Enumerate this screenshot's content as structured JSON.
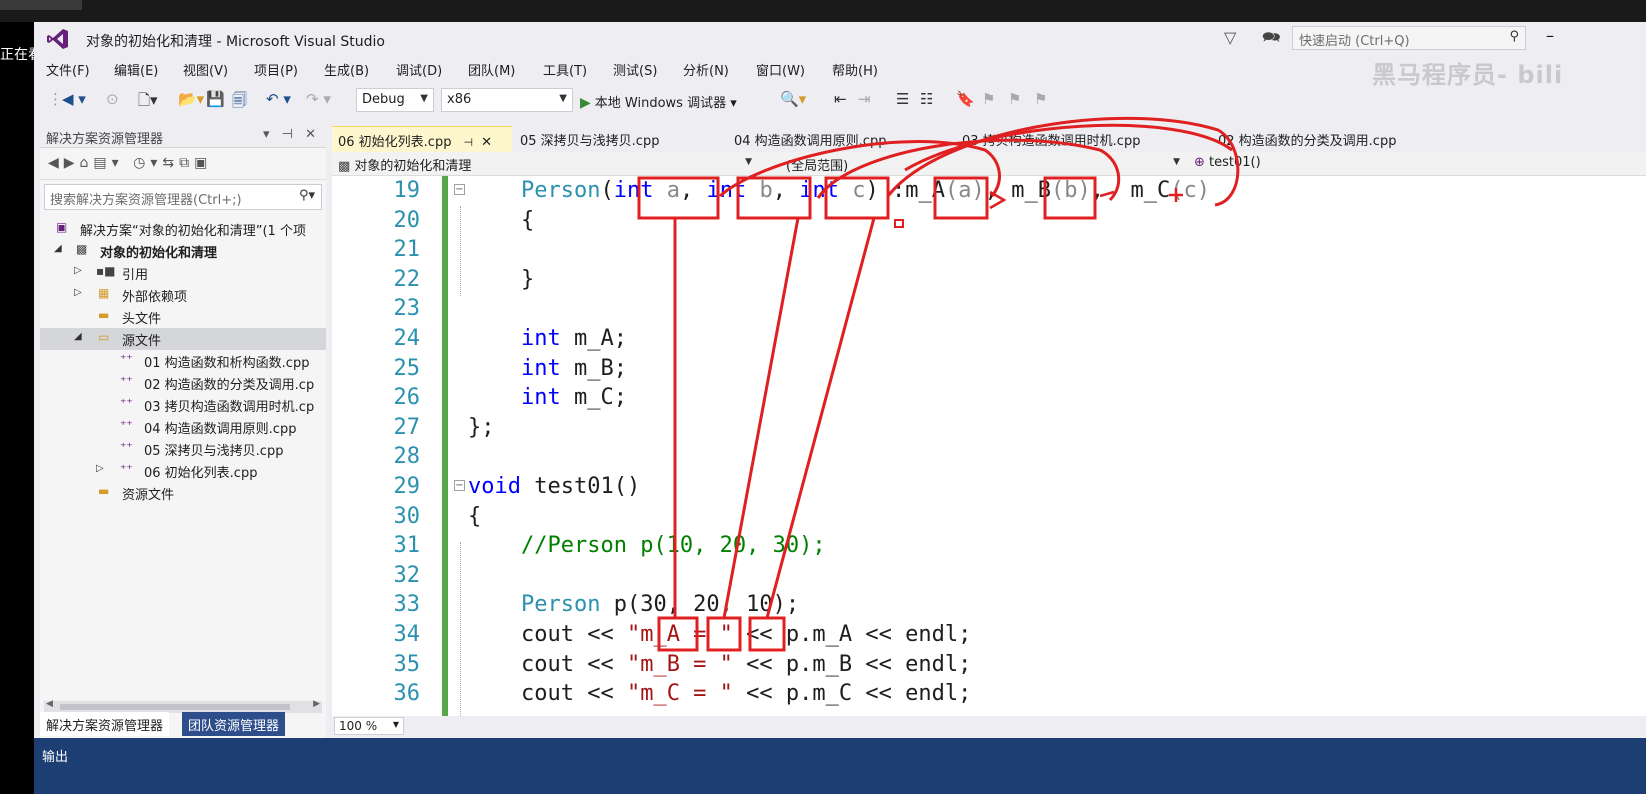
{
  "window": {
    "title": "对象的初始化和清理 - Microsoft Visual Studio",
    "side_text": "正在看",
    "quick_launch_placeholder": "快速启动 (Ctrl+Q)",
    "watermark": "黑马程序员- bili"
  },
  "menu": [
    "文件(F)",
    "编辑(E)",
    "视图(V)",
    "项目(P)",
    "生成(B)",
    "调试(D)",
    "团队(M)",
    "工具(T)",
    "测试(S)",
    "分析(N)",
    "窗口(W)",
    "帮助(H)"
  ],
  "toolbar": {
    "config": "Debug",
    "platform": "x86",
    "run_label": "本地 Windows 调试器"
  },
  "solution_explorer": {
    "title": "解决方案资源管理器",
    "search_placeholder": "搜索解决方案资源管理器(Ctrl+;)",
    "tree": [
      {
        "label": "解决方案“对象的初始化和清理”(1 个项",
        "icon": "solution-icon"
      },
      {
        "label": "对象的初始化和清理",
        "icon": "project-icon",
        "bold": true
      },
      {
        "label": "引用",
        "icon": "references-icon"
      },
      {
        "label": "外部依赖项",
        "icon": "external-deps-icon"
      },
      {
        "label": "头文件",
        "icon": "folder-icon"
      },
      {
        "label": "源文件",
        "icon": "folder-icon",
        "selected": true
      },
      {
        "label": "01 构造函数和析构函数.cpp",
        "icon": "cpp-file-icon"
      },
      {
        "label": "02 构造函数的分类及调用.cp",
        "icon": "cpp-file-icon"
      },
      {
        "label": "03 拷贝构造函数调用时机.cp",
        "icon": "cpp-file-icon"
      },
      {
        "label": "04 构造函数调用原则.cpp",
        "icon": "cpp-file-icon"
      },
      {
        "label": "05 深拷贝与浅拷贝.cpp",
        "icon": "cpp-file-icon"
      },
      {
        "label": "06 初始化列表.cpp",
        "icon": "cpp-file-icon"
      },
      {
        "label": "资源文件",
        "icon": "folder-icon"
      }
    ],
    "bottom_tabs": [
      "解决方案资源管理器",
      "团队资源管理器"
    ]
  },
  "editor": {
    "tabs": [
      "06 初始化列表.cpp",
      "05 深拷贝与浅拷贝.cpp",
      "04 构造函数调用原则.cpp",
      "03 拷贝构造函数调用时机.cpp",
      "02 构造函数的分类及调用.cpp"
    ],
    "nav": {
      "project": "对象的初始化和清理",
      "scope": "(全局范围)",
      "member": "test01()"
    },
    "zoom": "100 %",
    "lines": [
      {
        "n": "19",
        "tokens": [
          [
            "",
            "    "
          ],
          [
            "ty",
            "Person"
          ],
          [
            "",
            "("
          ],
          [
            "kw",
            "int"
          ],
          [
            "gr",
            " a"
          ],
          [
            "",
            ", "
          ],
          [
            "kw",
            "int"
          ],
          [
            "gr",
            " b"
          ],
          [
            "",
            ", "
          ],
          [
            "kw",
            "int"
          ],
          [
            "gr",
            " c"
          ],
          [
            "",
            ") :"
          ],
          [
            "",
            "m_A"
          ],
          [
            "gr",
            "(a)"
          ],
          [
            "",
            ", "
          ],
          [
            "",
            "m_B"
          ],
          [
            "gr",
            "(b)"
          ],
          [
            "",
            ",  "
          ],
          [
            "",
            "m_C"
          ],
          [
            "gr",
            "(c)"
          ]
        ]
      },
      {
        "n": "20",
        "tokens": [
          [
            "",
            "    {"
          ]
        ]
      },
      {
        "n": "21",
        "tokens": []
      },
      {
        "n": "22",
        "tokens": [
          [
            "",
            "    }"
          ]
        ]
      },
      {
        "n": "23",
        "tokens": []
      },
      {
        "n": "24",
        "tokens": [
          [
            "",
            "    "
          ],
          [
            "kw",
            "int"
          ],
          [
            "",
            " m_A;"
          ]
        ]
      },
      {
        "n": "25",
        "tokens": [
          [
            "",
            "    "
          ],
          [
            "kw",
            "int"
          ],
          [
            "",
            " m_B;"
          ]
        ]
      },
      {
        "n": "26",
        "tokens": [
          [
            "",
            "    "
          ],
          [
            "kw",
            "int"
          ],
          [
            "",
            " m_C;"
          ]
        ]
      },
      {
        "n": "27",
        "tokens": [
          [
            "",
            "};"
          ]
        ]
      },
      {
        "n": "28",
        "tokens": []
      },
      {
        "n": "29",
        "tokens": [
          [
            "kw",
            "void"
          ],
          [
            "",
            " test01()"
          ]
        ]
      },
      {
        "n": "30",
        "tokens": [
          [
            "",
            "{"
          ]
        ]
      },
      {
        "n": "31",
        "tokens": [
          [
            "",
            "    "
          ],
          [
            "cm",
            "//Person p(10, 20, 30);"
          ]
        ]
      },
      {
        "n": "32",
        "tokens": []
      },
      {
        "n": "33",
        "tokens": [
          [
            "",
            "    "
          ],
          [
            "ty",
            "Person"
          ],
          [
            "",
            " p(30, 20, 10);"
          ]
        ]
      },
      {
        "n": "34",
        "tokens": [
          [
            "",
            "    cout << "
          ],
          [
            "st",
            "\"m_A = \""
          ],
          [
            "",
            " << p.m_A << endl;"
          ]
        ]
      },
      {
        "n": "35",
        "tokens": [
          [
            "",
            "    cout << "
          ],
          [
            "st",
            "\"m_B = \""
          ],
          [
            "",
            " << p.m_B << endl;"
          ]
        ]
      },
      {
        "n": "36",
        "tokens": [
          [
            "",
            "    cout << "
          ],
          [
            "st",
            "\"m_C = \""
          ],
          [
            "",
            " << p.m_C << endl;"
          ]
        ]
      }
    ]
  },
  "status": {
    "output_label": "输出"
  },
  "colors": {
    "annotation": "#e02020",
    "status_bar": "#1c3e73",
    "active_tab": "#fef6cd"
  }
}
